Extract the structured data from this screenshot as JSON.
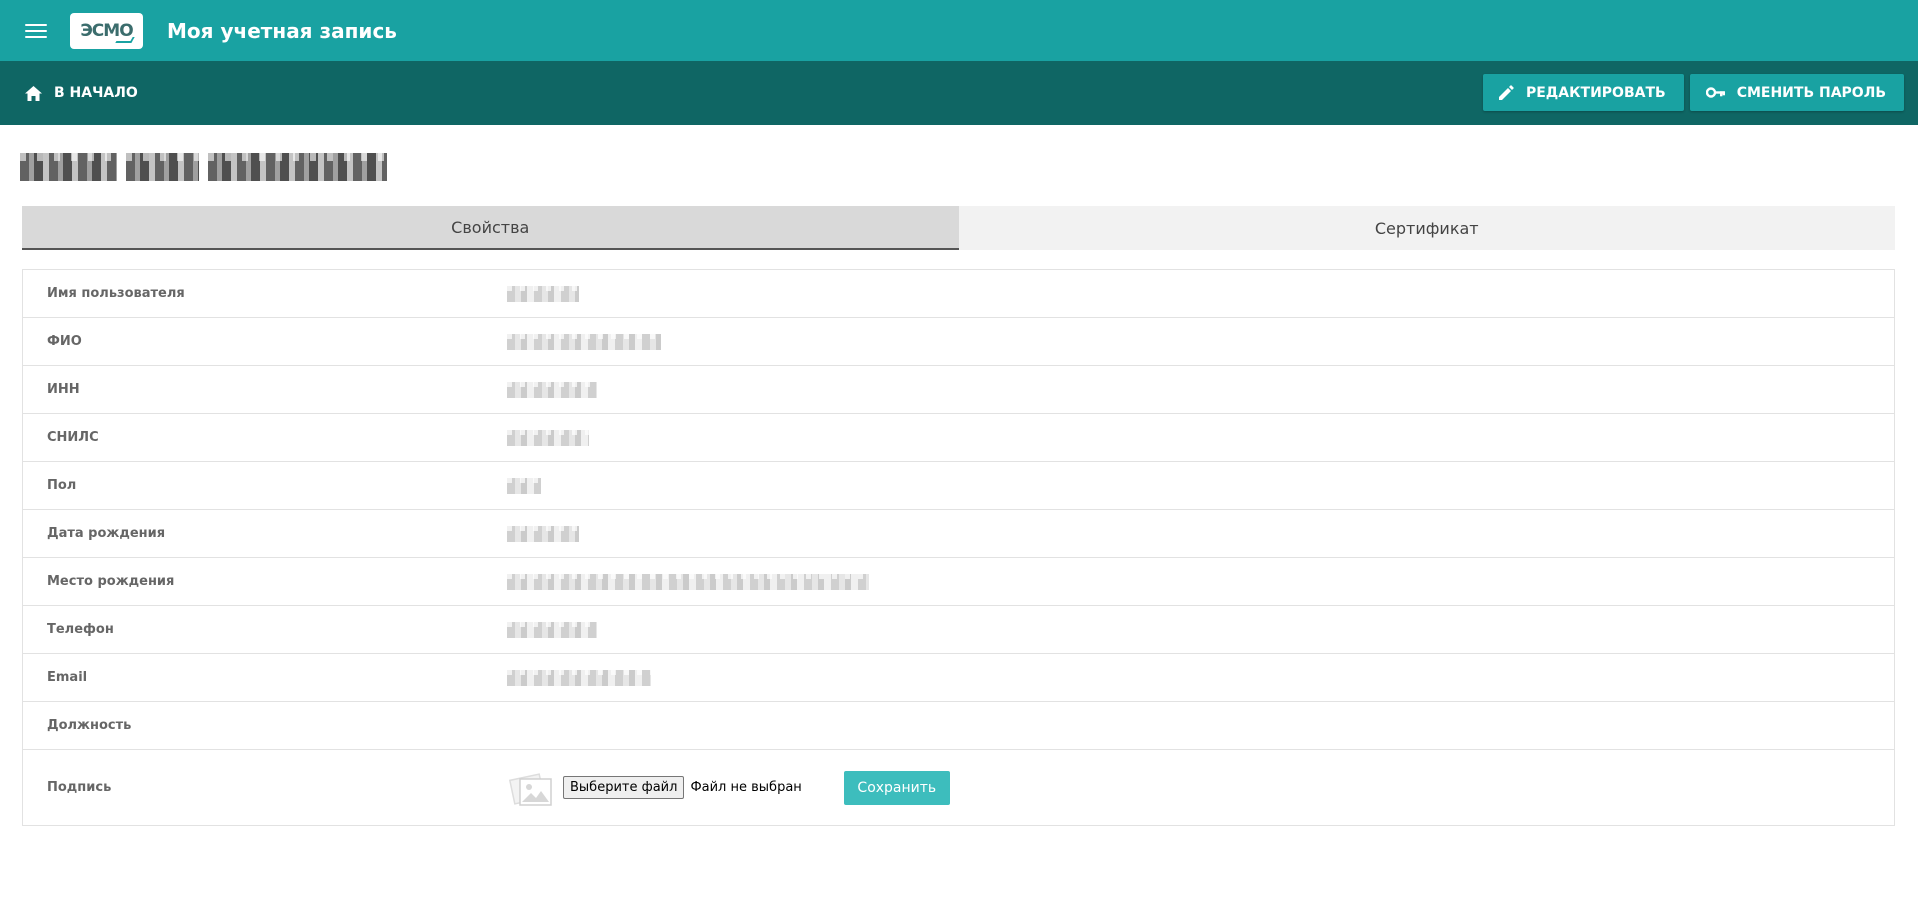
{
  "appbar": {
    "title": "Моя учетная запись",
    "logo_text": "ЭСМО"
  },
  "toolbar": {
    "home_label": "В НАЧАЛО",
    "edit_label": "РЕДАКТИРОВАТЬ",
    "change_password_label": "СМЕНИТЬ ПАРОЛЬ"
  },
  "tabs": [
    {
      "label": "Свойства",
      "active": true
    },
    {
      "label": "Сертификат",
      "active": false
    }
  ],
  "properties": [
    {
      "label": "Имя пользователя"
    },
    {
      "label": "ФИО"
    },
    {
      "label": "ИНН"
    },
    {
      "label": "СНИЛС"
    },
    {
      "label": "Пол"
    },
    {
      "label": "Дата рождения"
    },
    {
      "label": "Место рождения"
    },
    {
      "label": "Телефон"
    },
    {
      "label": "Email"
    },
    {
      "label": "Должность"
    }
  ],
  "signature": {
    "label": "Подпись",
    "file_button": "Выберите файл",
    "file_status": "Файл не выбран",
    "save_label": "Сохранить"
  },
  "colors": {
    "appbar": "#19a2a2",
    "toolbar": "#0f6664",
    "save_button": "#3dbdbd"
  },
  "icons": {
    "menu": "menu-icon",
    "home": "home-icon",
    "edit": "pencil-icon",
    "password": "key-icon",
    "signature": "image-placeholder-icon"
  }
}
